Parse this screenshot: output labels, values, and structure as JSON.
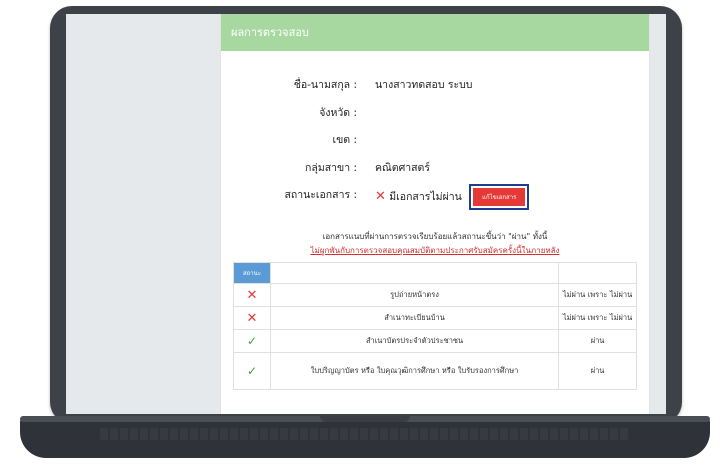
{
  "panel": {
    "header_title": "ผลการตรวจสอบ"
  },
  "info": {
    "name_label": "ชื่อ-นามสกุล :",
    "name_value": "นางสาวทดสอบ ระบบ",
    "province_label": "จังหวัด :",
    "district_label": "เขต :",
    "subject_label": "กลุ่มสาขา :",
    "subject_value": "คณิตศาสตร์",
    "doc_status_label": "สถานะเอกสาร :",
    "doc_status_value": "มีเอกสารไม่ผ่าน",
    "edit_button_label": "แก้ไขเอกสาร"
  },
  "notes": {
    "line1": "เอกสารแนบที่ผ่านการตรวจเรียบร้อยแล้วสถานะขึ้นว่า \"ผ่าน\" ทั้งนี้",
    "line2": "ไม่ผูกพันกับการตรวจสอบคุณสมบัติตามประกาศรับสมัครครั้งนี้ในภายหลัง"
  },
  "table": {
    "header_status": "สถานะ",
    "rows": [
      {
        "status": "fail",
        "doc": "รูปถ่ายหน้าตรง",
        "result": "ไม่ผ่าน เพราะ ไม่ผ่าน"
      },
      {
        "status": "fail",
        "doc": "สำเนาทะเบียนบ้าน",
        "result": "ไม่ผ่าน เพราะ ไม่ผ่าน"
      },
      {
        "status": "pass",
        "doc": "สำเนาบัตรประจำตัวประชาชน",
        "result": "ผ่าน"
      },
      {
        "status": "pass",
        "doc": "ใบปริญญาบัตร หรือ ใบคุณวุฒิการศึกษา หรือ ใบรับรองการศึกษา",
        "result": "ผ่าน"
      }
    ]
  },
  "icons": {
    "fail": "x-mark-icon",
    "pass": "check-mark-icon"
  },
  "colors": {
    "header_green": "#a6d8a0",
    "fail_red": "#e53935",
    "pass_green": "#43a047",
    "status_blue": "#5b9bd5"
  }
}
